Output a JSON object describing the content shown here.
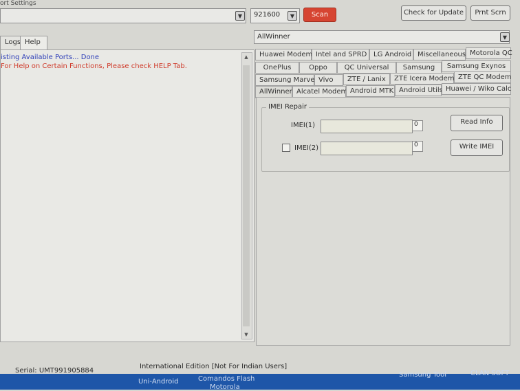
{
  "port_settings": {
    "title": "ort Settings",
    "port_value": "",
    "baud_value": "921600",
    "scan_label": "Scan"
  },
  "top_buttons": {
    "check_update": "Check for Update",
    "print_screen": "Prnt Scrn"
  },
  "left_tabs": [
    "Logs",
    "Help"
  ],
  "log_lines": [
    {
      "text": "isting Available Ports... Done",
      "color": "#2f3fb8"
    },
    {
      "text": "For Help on Certain Functions, Please check HELP Tab.",
      "color": "#cf3a2a"
    }
  ],
  "platform_select": {
    "value": "AllWinner"
  },
  "module_tabs": {
    "row1": [
      "Huawei Modem",
      "Intel and SPRD",
      "LG Android",
      "Miscellaneous",
      "Motorola QC"
    ],
    "row2": [
      "OnePlus",
      "Oppo",
      "QC Universal",
      "Samsung",
      "Samsung Exynos"
    ],
    "row3": [
      "Samsung Marvel",
      "Vivo",
      "ZTE / Lanix",
      "ZTE Icera Modem",
      "ZTE QC Modem"
    ],
    "row4": [
      "AllWinner",
      "Alcatel Modem",
      "Android MTK",
      "Android Utils",
      "Huawei / Wiko Calc"
    ]
  },
  "imei_repair": {
    "group_title": "IMEI Repair",
    "imei1_label": "IMEI(1)",
    "imei1_value": "",
    "imei1_count": "0",
    "imei2_label": "IMEI(2)",
    "imei2_value": "",
    "imei2_count": "0",
    "imei2_checked": false,
    "read_info": "Read Info",
    "write_imei": "Write IMEI"
  },
  "status": {
    "serial": "Serial: UMT991905884",
    "edition": "International Edition [Not For Indian Users]"
  },
  "taskbar": {
    "items": [
      "Uni-Android",
      "Comandos Flash",
      "Motorola",
      "Samsung Tool",
      "CLAN SOFT"
    ]
  }
}
